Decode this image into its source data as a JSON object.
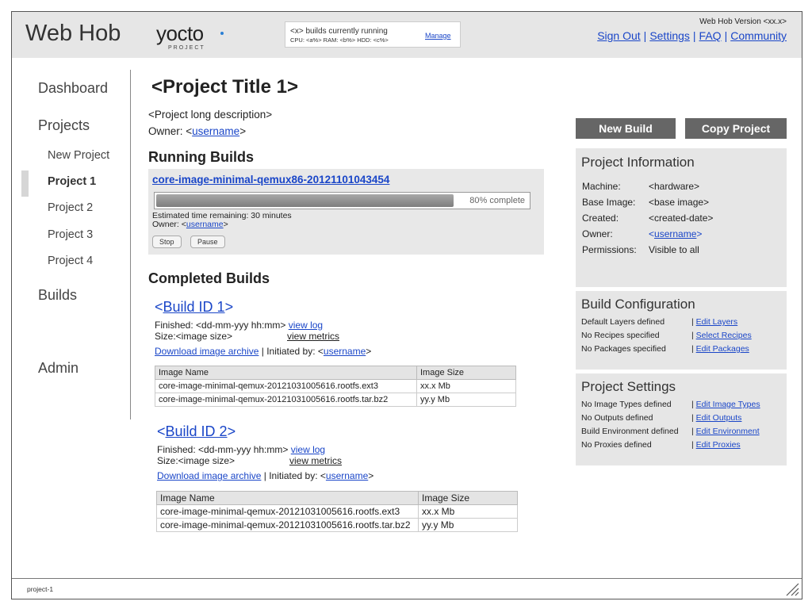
{
  "header": {
    "app_title": "Web Hob",
    "logo_word": "yocto",
    "logo_sub": "PROJECT",
    "status_line1": "<x> builds currently running",
    "status_line2": "CPU: <a%>   RAM: <b%>   HDD: <c%>",
    "manage_label": "Manage",
    "version": "Web Hob Version <xx.x>",
    "links": [
      "Sign Out",
      "Settings",
      "FAQ",
      "Community"
    ]
  },
  "sidebar": {
    "dashboard": "Dashboard",
    "projects": "Projects",
    "project_items": [
      "New Project",
      "Project 1",
      "Project 2",
      "Project 3",
      "Project 4"
    ],
    "builds": "Builds",
    "admin": "Admin"
  },
  "main": {
    "title": "<Project Title 1>",
    "description": "<Project long description>",
    "owner_prefix": "Owner: <",
    "owner_name": "username",
    "owner_suffix": ">",
    "running_heading": "Running Builds",
    "running": {
      "name": "core-image-minimal-qemux86-20121101043454",
      "progress_fraction": 0.8,
      "progress_text": "80% complete",
      "eta": "Estimated time remaining: 30 minutes",
      "owner_prefix": "Owner: <",
      "owner_name": "username",
      "owner_suffix": ">",
      "stop_label": "Stop",
      "pause_label": "Pause"
    },
    "completed_heading": "Completed Builds",
    "builds": [
      {
        "lt": "<",
        "id": "Build ID 1",
        "gt": ">",
        "finished": "Finished: <dd-mm-yyy hh:mm>",
        "view_log": "view log",
        "size": "Size:<image size>",
        "view_metrics": "view metrics",
        "download": "Download image archive",
        "initiated_prefix": " | Initiated by: <",
        "initiated_user": "username",
        "initiated_suffix": ">",
        "columns": [
          "Image Name",
          "Image Size"
        ],
        "rows": [
          [
            "core-image-minimal-qemux-20121031005616.rootfs.ext3",
            "xx.x Mb"
          ],
          [
            "core-image-minimal-qemux-20121031005616.rootfs.tar.bz2",
            "yy.y Mb"
          ]
        ]
      },
      {
        "lt": "<",
        "id": "Build ID 2",
        "gt": ">",
        "finished": "Finished: <dd-mm-yyy hh:mm>",
        "view_log": "view log",
        "size": "Size:<image size>",
        "view_metrics": "view metrics",
        "download": "Download image archive",
        "initiated_prefix": " | Initiated by: <",
        "initiated_user": "username",
        "initiated_suffix": ">",
        "columns": [
          "Image Name",
          "Image Size"
        ],
        "rows": [
          [
            "core-image-minimal-qemux-20121031005616.rootfs.ext3",
            "xx.x Mb"
          ],
          [
            "core-image-minimal-qemux-20121031005616.rootfs.tar.bz2",
            "yy.y Mb"
          ]
        ]
      }
    ]
  },
  "right": {
    "new_build_label": "New Build",
    "copy_project_label": "Copy Project",
    "project_info": {
      "heading": "Project Information",
      "machine_label": "Machine:",
      "machine_value": "<hardware>",
      "base_label": "Base Image:",
      "base_value": "<base image>",
      "created_label": "Created:",
      "created_value": "<created-date>",
      "owner_label": "Owner:",
      "owner_lt": "<",
      "owner_value": "username",
      "owner_gt": ">",
      "perm_label": "Permissions:",
      "perm_value": "Visible to all"
    },
    "build_config": {
      "heading": "Build Configuration",
      "rows": [
        {
          "label": "Default Layers defined",
          "link": "Edit Layers"
        },
        {
          "label": "No Recipes specified",
          "link": "Select Recipes"
        },
        {
          "label": "No Packages specified",
          "link": "Edit Packages"
        }
      ]
    },
    "project_settings": {
      "heading": "Project Settings",
      "rows": [
        {
          "label": "No Image Types defined",
          "link": "Edit Image Types"
        },
        {
          "label": "No Outputs defined",
          "link": "Edit Outputs"
        },
        {
          "label": "Build Environment defined",
          "link": "Edit Environment"
        },
        {
          "label": "No Proxies defined",
          "link": "Edit Proxies"
        }
      ]
    },
    "link_separator": "|"
  },
  "footer": {
    "text": "project-1"
  },
  "colors": {
    "header_bg": "#e6e6e6",
    "link": "#1a46c8",
    "button_bg": "#666666",
    "panel_bg": "#e6e6e6"
  }
}
